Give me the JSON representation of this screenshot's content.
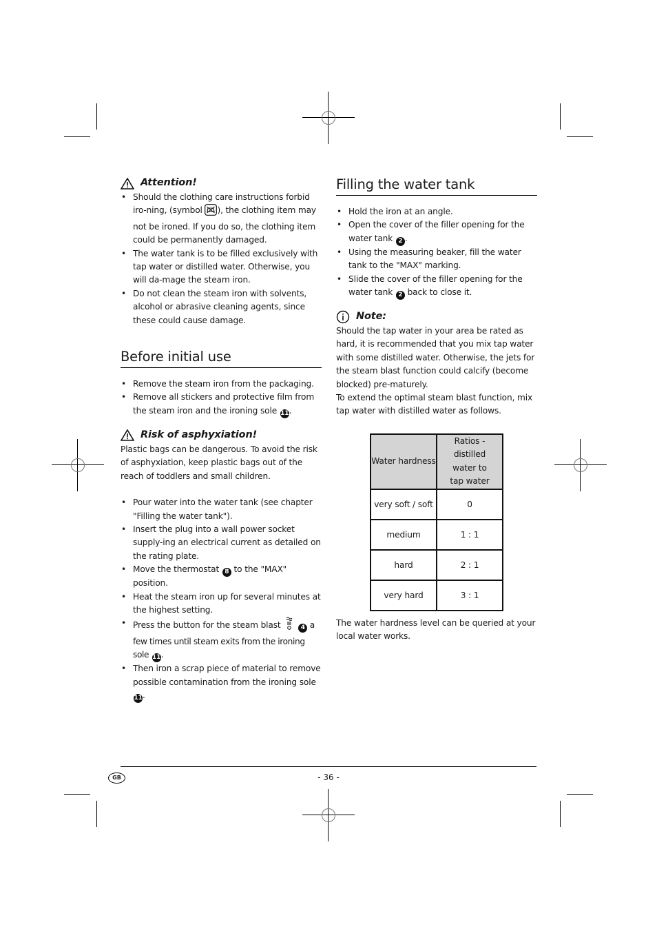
{
  "left_column": {
    "attention": {
      "heading": "Attention!",
      "icon": "warning-triangle-icon",
      "items": [
        {
          "before": "Should the clothing care instructions forbid iro-ning, (symbol ",
          "symbol": "do-not-iron-icon",
          "after": "), the clothing item may not be ironed. If you do so, the clothing item could be permanently damaged."
        },
        {
          "text": "The water tank is to be filled exclusively with tap water or distilled water. Otherwise, you will da-mage the steam iron."
        },
        {
          "text": "Do not clean the steam iron with solvents, alcohol or abrasive cleaning agents, since these could cause damage."
        }
      ]
    },
    "before_initial_use": {
      "title": "Before initial use",
      "items": [
        {
          "text": "Remove the steam iron from the packaging."
        },
        {
          "text": "Remove all stickers and protective film from the steam iron and the ironing sole ",
          "ref": "11",
          "suffix": "."
        }
      ]
    },
    "risk": {
      "heading": "Risk of asphyxiation!",
      "icon": "warning-triangle-icon",
      "text": "Plastic bags can be dangerous. To avoid the risk of asphyxiation, keep plastic bags out of the reach of toddlers and small children."
    },
    "steps": [
      {
        "text": "Pour water into the water tank (see chapter \"Filling the water tank\")."
      },
      {
        "text": "Insert the plug into a wall power socket supply-ing an electrical current as detailed on the rating plate."
      },
      {
        "text": "Move the thermostat ",
        "ref": "8",
        "suffix": " to the \"MAX\" position."
      },
      {
        "text": "Heat the steam iron up for several minutes at the highest setting."
      },
      {
        "text": "Press the button for the steam blast ",
        "symbol": "steam-blast-icon",
        "ref": "4",
        "mid": " a few times until steam exits from the ironing sole ",
        "ref2": "11",
        "suffix": "."
      },
      {
        "text": "Then iron a scrap piece of material to remove possible contamination from the ironing sole ",
        "ref": "11",
        "suffix": "."
      }
    ]
  },
  "right_column": {
    "filling": {
      "title": "Filling the water tank",
      "items": [
        {
          "text": "Hold the iron at an angle."
        },
        {
          "text": "Open the cover of the filler opening for the water tank ",
          "ref": "2",
          "suffix": "."
        },
        {
          "text": "Using the measuring beaker, fill the water tank to the \"MAX\" marking."
        },
        {
          "text": "Slide the cover of the filler opening for the water tank ",
          "ref": "2",
          "suffix": " back to close it."
        }
      ]
    },
    "note": {
      "heading": "Note:",
      "icon": "info-circle-icon",
      "paragraph1": "Should the tap water in your area be rated as hard, it is recommended that you mix tap water with some distilled water. Otherwise, the jets for the steam blast function could calcify (become blocked) pre-maturely.",
      "paragraph2": "To extend the optimal steam blast function, mix tap water with distilled water as follows."
    },
    "table": {
      "headers": [
        "Water hardness",
        "Ratios - distilled water to tap water"
      ],
      "header2_lines": [
        "Ratios - distilled",
        "water to",
        "tap water"
      ],
      "rows": [
        [
          "very soft / soft",
          "0"
        ],
        [
          "medium",
          "1 : 1"
        ],
        [
          "hard",
          "2 : 1"
        ],
        [
          "very hard",
          "3 : 1"
        ]
      ]
    },
    "closing": "The water hardness level can be queried at your local water works."
  },
  "footer": {
    "country": "GB",
    "page": "- 36 -"
  }
}
